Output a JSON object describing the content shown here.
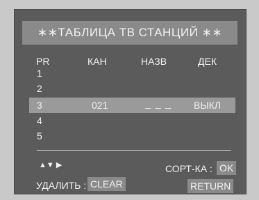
{
  "title": "∗∗ТАБЛИЦА ТВ СТАНЦИЙ ∗∗",
  "columns": {
    "pr": "PR",
    "channel": "КАН",
    "name": "НАЗВ",
    "decoder": "ДЕК"
  },
  "rows": [
    {
      "pr": "1",
      "channel": "",
      "name": "",
      "decoder": ""
    },
    {
      "pr": "2",
      "channel": "",
      "name": "",
      "decoder": ""
    },
    {
      "pr": "3",
      "channel": "021",
      "name": "_ _ _",
      "decoder": "ВЫКЛ"
    },
    {
      "pr": "4",
      "channel": "",
      "name": "",
      "decoder": ""
    },
    {
      "pr": "5",
      "channel": "",
      "name": "",
      "decoder": ""
    }
  ],
  "legend": {
    "nav_arrows": "▲▼ ▶"
  },
  "sort": {
    "label": "СОРТ-КА :",
    "button": "OK"
  },
  "delete": {
    "label": "УДАЛИТЬ :",
    "button": "CLEAR"
  },
  "return_button": "RETURN"
}
